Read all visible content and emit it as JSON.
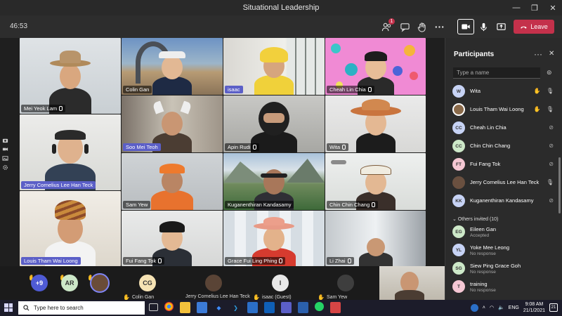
{
  "window": {
    "title": "Situational Leadership"
  },
  "toolbar": {
    "timer": "46:53",
    "participants_badge": "1",
    "leave_label": "Leave"
  },
  "tiles": [
    {
      "name": "Mei Yeok Lam"
    },
    {
      "name": "Colin Gan"
    },
    {
      "name": "isaac"
    },
    {
      "name": "Cheah Lin Chia"
    },
    {
      "name": "Soo Mei Teoh"
    },
    {
      "name": "Apin Rudi"
    },
    {
      "name": "Wita"
    },
    {
      "name": "Jerry Cornelius Lee Han Teck"
    },
    {
      "name": "Sam Yew"
    },
    {
      "name": "Kuganenthiran Kandasamy"
    },
    {
      "name": "Chin Chin Chang"
    },
    {
      "name": "Louis Tham Wai Loong"
    },
    {
      "name": "Fui Fang Tok"
    },
    {
      "name": "Grace Fui Ling Phing"
    },
    {
      "name": "Li Zhai"
    }
  ],
  "strip": {
    "more_count": "+9",
    "ar_initials": "AR",
    "cg_initials": "CG",
    "i_initials": "I",
    "names": [
      "Colin Gan",
      "Jerry Cornelius Lee Han Teck",
      "isaac (Guest)",
      "Sam Yew"
    ]
  },
  "panel": {
    "title": "Participants",
    "search_placeholder": "Type a name",
    "participants": [
      {
        "initials": "W",
        "name": "Wita",
        "color": "#c7d3f5"
      },
      {
        "initials": "",
        "name": "Louis Tham Wai Loong",
        "color": "#8a6a4a"
      },
      {
        "initials": "CC",
        "name": "Cheah Lin Chia",
        "color": "#c7d3f5"
      },
      {
        "initials": "CC",
        "name": "Chin Chin Chang",
        "color": "#cde8c8"
      },
      {
        "initials": "FT",
        "name": "Fui Fang Tok",
        "color": "#f5c7d3"
      },
      {
        "initials": "",
        "name": "Jerry Cornelius Lee Han Teck",
        "color": "#6a5040"
      },
      {
        "initials": "KK",
        "name": "Kuganenthiran Kandasamy",
        "color": "#c7d3f5"
      }
    ],
    "others_title": "Others invited (10)",
    "invited": [
      {
        "initials": "EG",
        "name": "Eileen Gan",
        "status": "Accepted",
        "color": "#cde8c8"
      },
      {
        "initials": "YL",
        "name": "Yoke Mee Leong",
        "status": "No response",
        "color": "#c7d3f5"
      },
      {
        "initials": "SG",
        "name": "Siew Ping Grace Goh",
        "status": "No response",
        "color": "#cde8c8"
      },
      {
        "initials": "T",
        "name": "training",
        "status": "No response",
        "color": "#f5c7d3"
      }
    ]
  },
  "taskbar": {
    "search_placeholder": "Type here to search",
    "language": "ENG",
    "time": "9:08 AM",
    "date": "21/1/2021",
    "notif_count": "21"
  }
}
